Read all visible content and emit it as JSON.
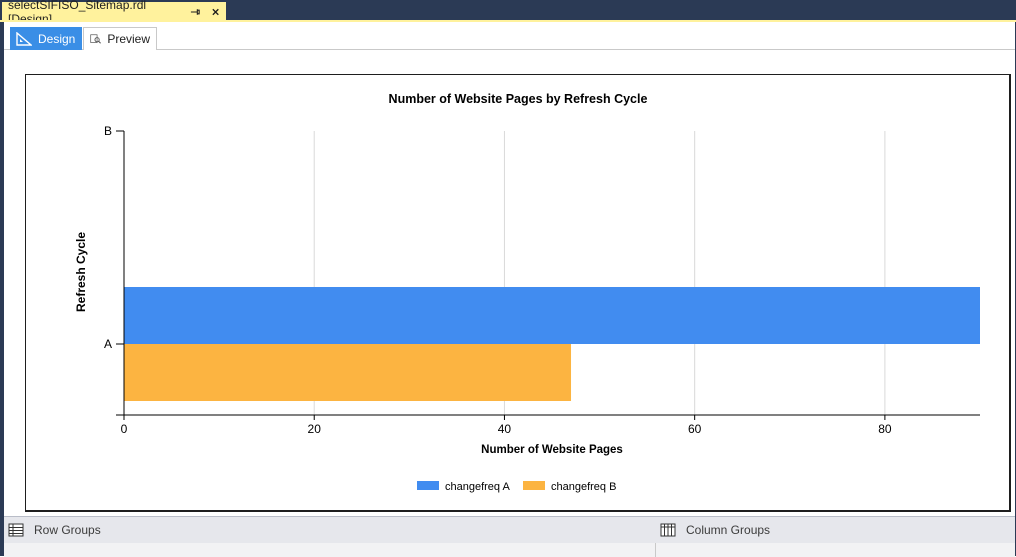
{
  "document_tab": {
    "title": "selectSIFISO_Sitemap.rdl [Design]"
  },
  "view_tabs": {
    "design": "Design",
    "preview": "Preview",
    "active": "Design"
  },
  "group_panes": {
    "row_groups": "Row Groups",
    "column_groups": "Column Groups"
  },
  "colors": {
    "series_a": "#418cf0",
    "series_b": "#fcb441"
  },
  "chart_data": {
    "type": "bar",
    "orientation": "horizontal",
    "title": "Number of Website Pages by Refresh Cycle",
    "xlabel": "Number of Website Pages",
    "ylabel": "Refresh Cycle",
    "categories": [
      "A",
      "B"
    ],
    "series": [
      {
        "name": "changefreq A",
        "values": [
          90,
          null
        ],
        "color": "#418cf0"
      },
      {
        "name": "changefreq B",
        "values": [
          47,
          null
        ],
        "color": "#fcb441"
      }
    ],
    "xlim": [
      0,
      90
    ],
    "x_ticks": [
      0,
      20,
      40,
      60,
      80
    ],
    "x_tick_labels": [
      "0",
      "20",
      "40",
      "60",
      "80"
    ],
    "grid": true,
    "legend_position": "bottom-center"
  }
}
